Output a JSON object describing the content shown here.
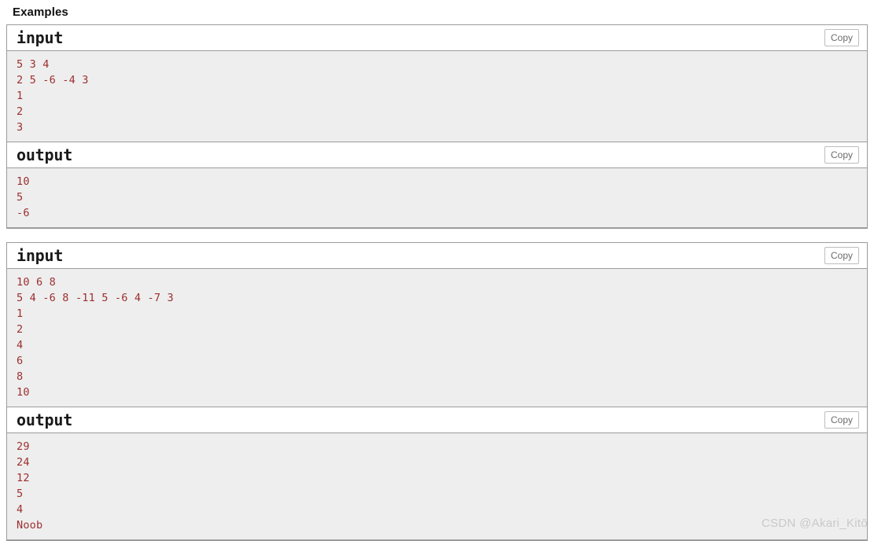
{
  "page": {
    "section_title": "Examples",
    "watermark": "CSDN @Akari_Kitō"
  },
  "labels": {
    "input": "input",
    "output": "output",
    "copy": "Copy"
  },
  "examples": [
    {
      "input_lines": [
        "5 3 4",
        "2 5 -6 -4 3",
        "1",
        "2",
        "3"
      ],
      "output_lines": [
        "10",
        "5",
        "-6"
      ]
    },
    {
      "input_lines": [
        "10 6 8",
        "5 4 -6 8 -11 5 -6 4 -7 3",
        "1",
        "2",
        "4",
        "6",
        "8",
        "10"
      ],
      "output_lines": [
        "29",
        "24",
        "12",
        "5",
        "4",
        "Noob"
      ]
    }
  ]
}
